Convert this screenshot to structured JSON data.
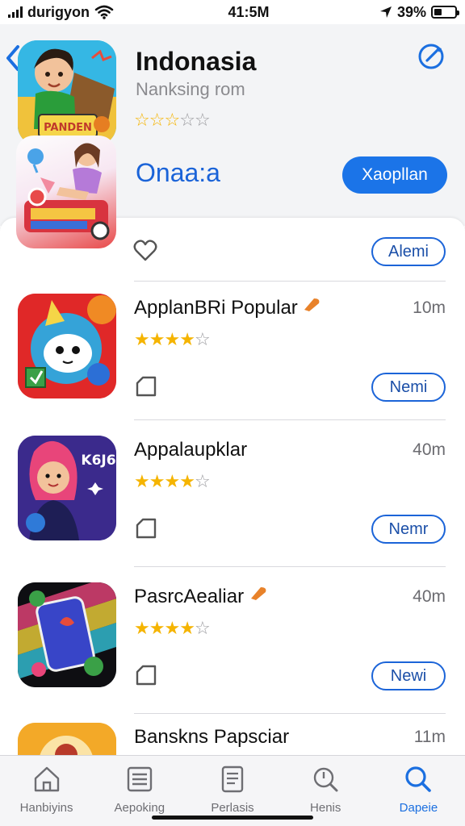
{
  "status_bar": {
    "carrier": "durigyon",
    "time": "41:5M",
    "battery": "39%",
    "battery_level": 0.39
  },
  "header": {
    "title": "Indonasia",
    "subtitle": "Nanksing rom",
    "rating": 3,
    "open_label": "Onaa:a",
    "primary_button": "Xaopllan",
    "icon_text": "PANDEN"
  },
  "first_row": {
    "button": "Alemi"
  },
  "apps": [
    {
      "name": "ApplanBRi Popular",
      "size": "10m",
      "rating": 4,
      "button": "Nemi",
      "icon_theme": "red-creature",
      "has_badge": true
    },
    {
      "name": "Appalaupklar",
      "size": "40m",
      "rating": 4,
      "button": "Nemr",
      "icon_theme": "purple-girl",
      "icon_text": "K6J6",
      "has_badge": false
    },
    {
      "name": "PasrcAealiar",
      "size": "40m",
      "rating": 4,
      "button": "Newi",
      "icon_theme": "rainbow-cards",
      "has_badge": true
    },
    {
      "name": "Banskns Papsciar",
      "size": "11m",
      "rating": 0,
      "button": "",
      "icon_theme": "yellow-partial",
      "has_badge": false
    }
  ],
  "tabs": [
    {
      "label": "Hanbiyins",
      "icon": "home-icon",
      "active": false
    },
    {
      "label": "Aepoking",
      "icon": "list-icon",
      "active": false
    },
    {
      "label": "Perlasis",
      "icon": "document-icon",
      "active": false
    },
    {
      "label": "Henis",
      "icon": "search-outline-icon",
      "active": false
    },
    {
      "label": "Dapeie",
      "icon": "search-icon",
      "active": true
    }
  ],
  "colors": {
    "accent": "#1b74e8",
    "star": "#f5b400",
    "text_secondary": "#8a8a8e"
  }
}
